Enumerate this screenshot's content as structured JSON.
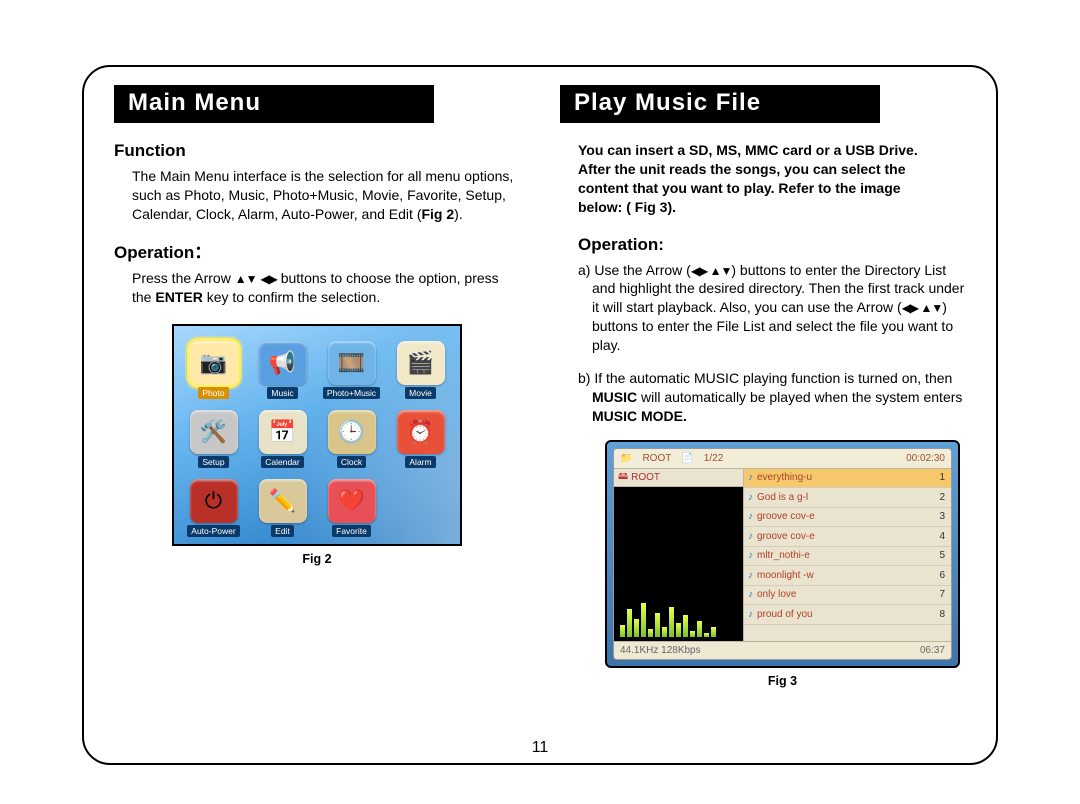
{
  "page_number": "11",
  "left": {
    "header": "Main Menu",
    "function_head": "Function",
    "function_text_1": "The Main Menu interface is the selection for all menu options, such as Photo, Music, Photo+Music, Movie, Favorite, Setup, Calendar, Clock, Alarm, Auto-Power, and Edit (",
    "function_text_bold": "Fig 2",
    "function_text_2": ").",
    "operation_head": "Operation：",
    "operation_text_1": "Press the Arrow ",
    "operation_text_2": " buttons to choose the option, press the ",
    "operation_bold": "ENTER",
    "operation_text_3": " key to confirm the selection.",
    "fig2_caption": "Fig 2",
    "fig2_tiles": [
      {
        "label": "Photo",
        "icon": "📷",
        "bg": "#ffe8a8",
        "sel": true
      },
      {
        "label": "Music",
        "icon": "📢",
        "bg": "#5aa0e0"
      },
      {
        "label": "Photo+Music",
        "icon": "🎞️",
        "bg": "#6fb4e8"
      },
      {
        "label": "Movie",
        "icon": "🎬",
        "bg": "#f2e8c8"
      },
      {
        "label": "Setup",
        "icon": "🛠️",
        "bg": "#c7c7c7"
      },
      {
        "label": "Calendar",
        "icon": "📅",
        "bg": "#e8e2c8"
      },
      {
        "label": "Clock",
        "icon": "🕒",
        "bg": "#d9c48a"
      },
      {
        "label": "Alarm",
        "icon": "⏰",
        "bg": "#e85038"
      },
      {
        "label": "Auto-Power",
        "icon": "⏻",
        "bg": "#b83028"
      },
      {
        "label": "Edit",
        "icon": "✏️",
        "bg": "#d8c89a"
      },
      {
        "label": "Favorite",
        "icon": "❤️",
        "bg": "#e85058"
      }
    ]
  },
  "right": {
    "header": "Play Music File",
    "intro": "You can insert a SD, MS, MMC card or a USB Drive. After the unit reads the songs, you can select the content that you want to play. Refer to the image below: ( Fig 3).",
    "operation_head": "Operation:",
    "op_a_1": "a) Use the Arrow (",
    "op_a_2": ") buttons to enter the Directory List and highlight the desired directory. Then the first track under it will start playback. Also, you can use the Arrow (",
    "op_a_3": ") buttons to enter the File List and select the file you want to play.",
    "op_b_1": "b) If the automatic MUSIC playing function is turned on, then ",
    "op_b_bold1": "MUSIC",
    "op_b_2": " will automatically be played when the system enters ",
    "op_b_bold2": "MUSIC MODE.",
    "fig3_caption": "Fig 3",
    "fig3": {
      "top_left": "ROOT",
      "top_mid": "1/22",
      "top_right": "00:02:30",
      "root_label": "ROOT",
      "bottom_left": "44.1KHz  128Kbps",
      "bottom_right": "06:37",
      "files": [
        {
          "name": "everything-u",
          "index": "1",
          "sel": true
        },
        {
          "name": "God is a g-l",
          "index": "2"
        },
        {
          "name": "groove cov-e",
          "index": "3"
        },
        {
          "name": "groove cov-e",
          "index": "4"
        },
        {
          "name": "mltr_nothi-e",
          "index": "5"
        },
        {
          "name": "moonlight -w",
          "index": "6"
        },
        {
          "name": "only love",
          "index": "7"
        },
        {
          "name": "proud of you",
          "index": "8"
        }
      ],
      "eq_heights": [
        12,
        28,
        18,
        34,
        8,
        24,
        10,
        30,
        14,
        22,
        6,
        16,
        4,
        10
      ]
    }
  },
  "arrow_glyphs": {
    "updown": "▲▼",
    "leftright": "◀▶",
    "lr_ud": "◀▶ ▲▼"
  }
}
